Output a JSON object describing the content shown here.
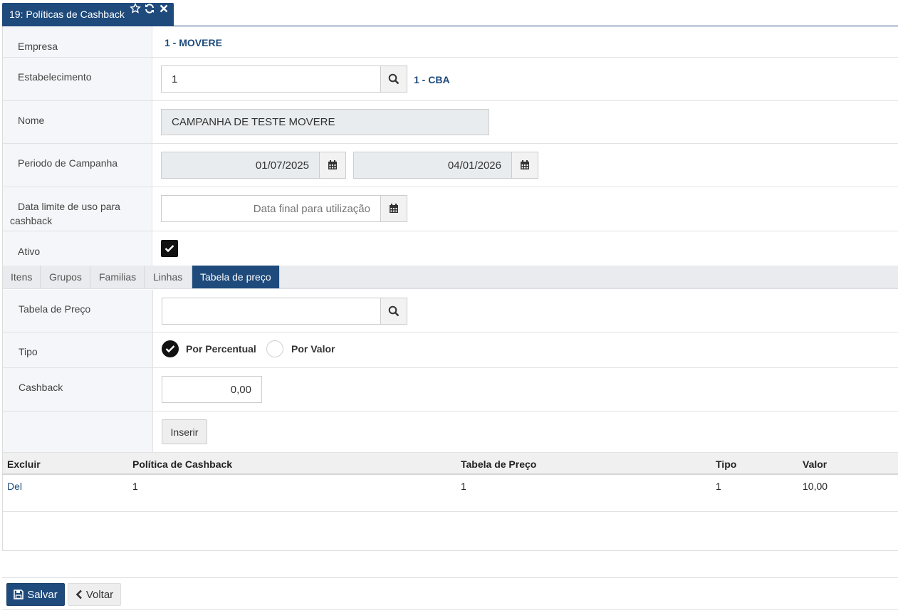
{
  "window": {
    "title": "19: Políticas de Cashback"
  },
  "form": {
    "empresa": {
      "label": "Empresa",
      "value": "1 - MOVERE"
    },
    "estabelecimento": {
      "label": "Estabelecimento",
      "value": "1",
      "desc": "1 - CBA"
    },
    "nome": {
      "label": "Nome",
      "value": "CAMPANHA DE TESTE MOVERE"
    },
    "periodo": {
      "label": "Periodo de Campanha",
      "start": "01/07/2025",
      "end": "04/01/2026"
    },
    "data_limite": {
      "label_line1": "Data limite de uso para",
      "label_line2": "cashback",
      "placeholder": "Data final para utilização",
      "value": ""
    },
    "ativo": {
      "label": "Ativo",
      "checked": true
    }
  },
  "subtabs": [
    {
      "label": "Itens"
    },
    {
      "label": "Grupos"
    },
    {
      "label": "Familias"
    },
    {
      "label": "Linhas"
    },
    {
      "label": "Tabela de preço",
      "active": true
    }
  ],
  "price_tab": {
    "tabela": {
      "label": "Tabela de Preço",
      "value": ""
    },
    "tipo": {
      "label": "Tipo",
      "option1": "Por Percentual",
      "option2": "Por Valor",
      "selected": "Por Percentual"
    },
    "cashback": {
      "label": "Cashback",
      "value": "0,00"
    },
    "insert_label": "Inserir"
  },
  "grid": {
    "headers": [
      "Excluir",
      "Política de Cashback",
      "Tabela de Preço",
      "Tipo",
      "Valor"
    ],
    "rows": [
      {
        "excluir": "Del",
        "politica": "1",
        "tabela": "1",
        "tipo": "1",
        "valor": "10,00"
      }
    ]
  },
  "footer": {
    "save_label": "Salvar",
    "back_label": "Voltar"
  },
  "colors": {
    "accent": "#1e4a7c"
  }
}
